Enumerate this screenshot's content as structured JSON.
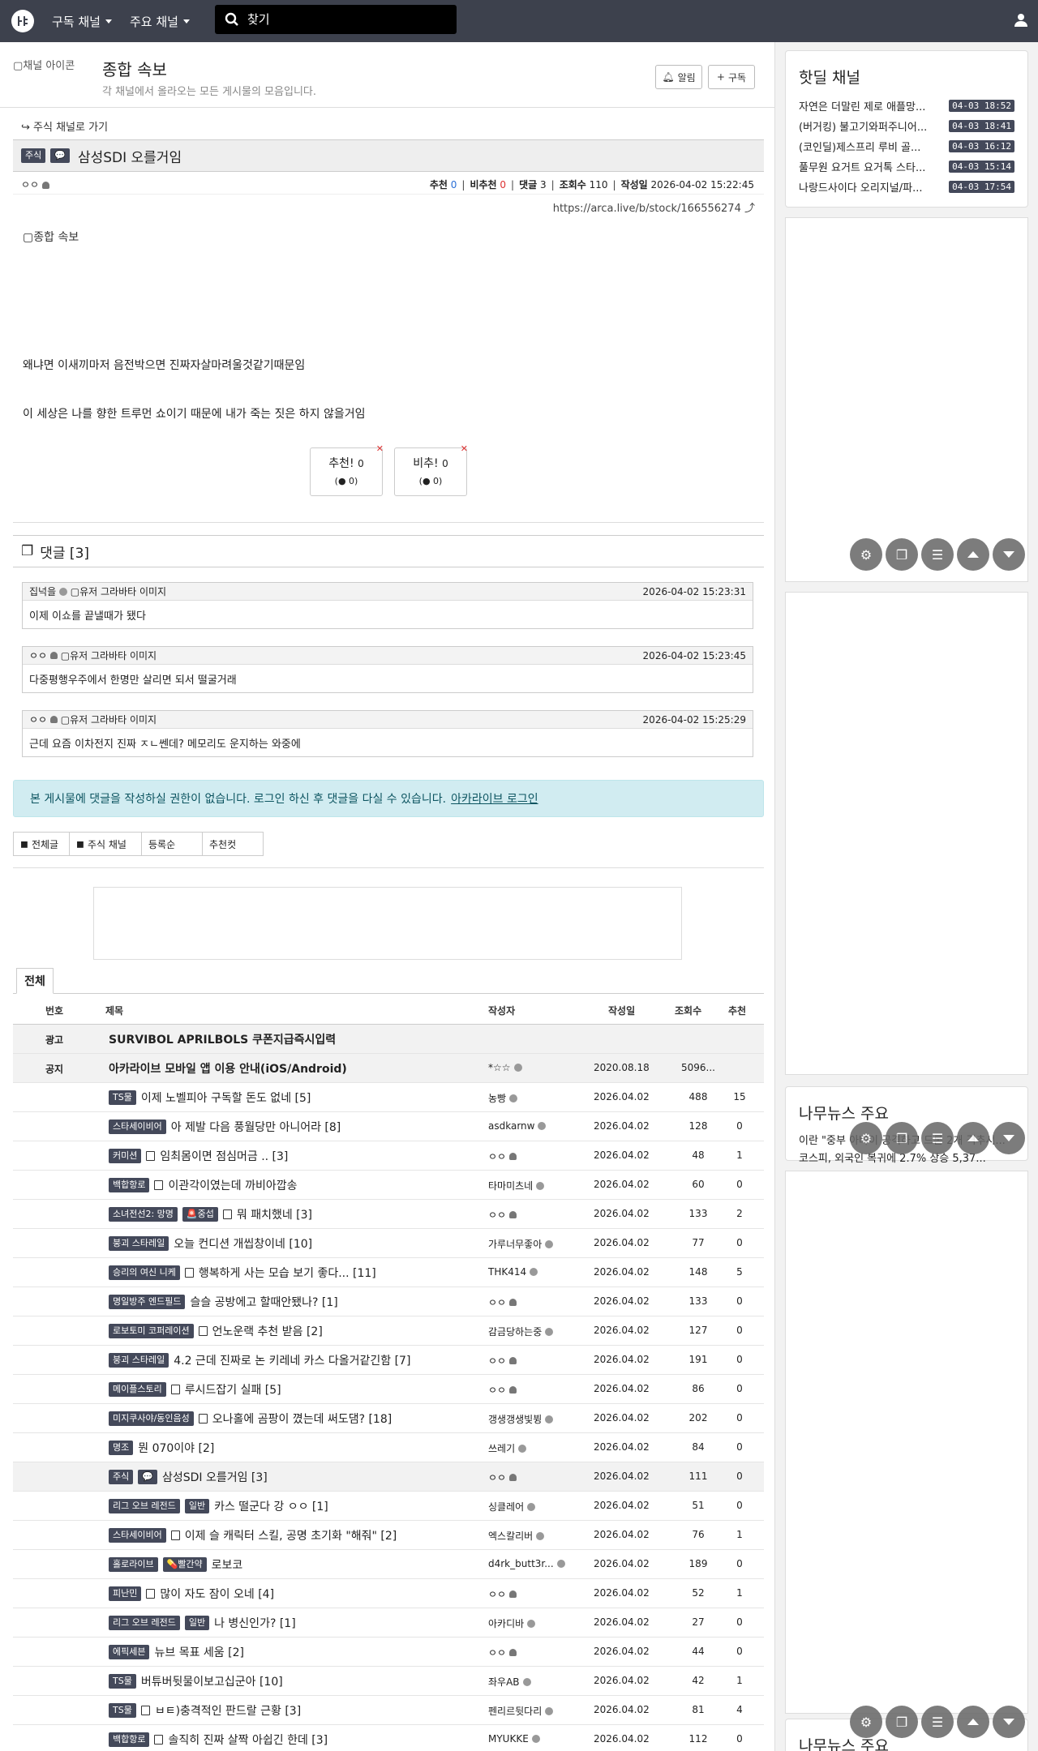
{
  "topbar": {
    "logo": "arca",
    "menu1": "구독 채널",
    "menu2": "주요 채널",
    "search_placeholder": "찾기"
  },
  "channel": {
    "img_alt": "채널 아이콘",
    "title": "종합 속보",
    "desc": "각 채널에서 올라오는 모든 게시물의 모음입니다.",
    "btn_alarm": "알림",
    "btn_sub": "구독"
  },
  "back": "주식 채널로 가기",
  "article": {
    "badge1": "주식",
    "title": "삼성SDI 오를거임",
    "author": "ㅇㅇ",
    "meta": {
      "rec_label": "추천",
      "rec": "0",
      "unrec_label": "비추천",
      "unrec": "0",
      "cmt_label": "댓글",
      "cmt": "3",
      "view_label": "조회수",
      "views": "110",
      "date_label": "작성일",
      "date": "2026-04-02 15:22:45"
    },
    "url": "https://arca.live/b/stock/166556274",
    "img_alt": "종합 속보",
    "p1": "왜냐면 이새끼마저 음전박으면 진짜자살마려울것같기때문임",
    "p2": "이 세상은 나를 향한 트루먼 쇼이기 때문에 내가 죽는 짓은 하지 않을거임",
    "vote_up": "추천!",
    "vote_up_n": "0",
    "vote_up_sub": "0",
    "vote_down": "비추!",
    "vote_down_n": "0",
    "vote_down_sub": "0"
  },
  "comments": {
    "title": "댓글 [3]",
    "items": [
      {
        "author": "집넉을",
        "avatar_alt": "유저 그라바타 이미지",
        "date": "2026-04-02 15:23:31",
        "text": "이제 이쇼를 끝낼때가 됐다"
      },
      {
        "author": "ㅇㅇ",
        "avatar_alt": "유저 그라바타 이미지",
        "date": "2026-04-02 15:23:45",
        "text": "다중평행우주에서 한명만 살리면 되서 떨굴거래"
      },
      {
        "author": "ㅇㅇ",
        "avatar_alt": "유저 그라바타 이미지",
        "date": "2026-04-02 15:25:29",
        "text": "근데 요즘 이차전지 진짜 ㅈㄴ쎈데? 메모리도 운지하는 와중에"
      }
    ]
  },
  "notice": {
    "text": "본 게시물에 댓글을 작성하실 권한이 없습니다. 로그인 하신 후 댓글을 다실 수 있습니다.",
    "link": "아카라이브 로그인"
  },
  "filters": [
    "전체글",
    "주식 채널",
    "등록순",
    "추천컷"
  ],
  "tab": "전체",
  "table": {
    "headers": [
      "번호",
      "제목",
      "작성자",
      "작성일",
      "조회수",
      "추천"
    ],
    "rows": [
      {
        "no": "광고",
        "title": "SURVIBOL APRILBOLS 쿠폰지급즉시입력",
        "bold": true,
        "shaded": true,
        "author": "",
        "date": "",
        "views": "",
        "rec": ""
      },
      {
        "no": "공지",
        "title": "아카라이브 모바일 앱 이용 안내(iOS/Android)",
        "bold": true,
        "shaded": true,
        "author": "*☆☆",
        "date": "2020.08.18",
        "views": "5096...",
        "rec": ""
      },
      {
        "no": "",
        "badges": [
          "TS물"
        ],
        "title": "이제 노벨피아 구독할 돈도 없네 [5]",
        "author": "농빵",
        "date": "2026.04.02",
        "views": "488",
        "rec": "15"
      },
      {
        "no": "",
        "badges": [
          "스타세이비어"
        ],
        "title": "아 제발 다음 풍월당만 아니어라 [8]",
        "author": "asdkarnw",
        "date": "2026.04.02",
        "views": "128",
        "rec": "0"
      },
      {
        "no": "",
        "badges": [
          "커미션"
        ],
        "doc": true,
        "title": "임최몸이면 점심머금 .. [3]",
        "author": "ㅇㅇ",
        "date": "2026.04.02",
        "views": "48",
        "rec": "1"
      },
      {
        "no": "",
        "badges": [
          "백합항로"
        ],
        "doc": true,
        "title": "이관각이였는데 까비아깝송",
        "author": "타마미츠네",
        "date": "2026.04.02",
        "views": "60",
        "rec": "0"
      },
      {
        "no": "",
        "badges": [
          "소녀전선2: 망명",
          "🚨중섭"
        ],
        "doc": true,
        "title": "뭐 패치했네 [3]",
        "author": "ㅇㅇ",
        "date": "2026.04.02",
        "views": "133",
        "rec": "2"
      },
      {
        "no": "",
        "badges": [
          "붕괴 스타레일"
        ],
        "title": "오늘 컨디션 개씹창이네 [10]",
        "author": "가루너무좋아",
        "date": "2026.04.02",
        "views": "77",
        "rec": "0"
      },
      {
        "no": "",
        "badges": [
          "승리의 여신 니케"
        ],
        "doc": true,
        "title": "행복하게 사는 모습 보기 좋다... [11]",
        "author": "THK414",
        "date": "2026.04.02",
        "views": "148",
        "rec": "5"
      },
      {
        "no": "",
        "badges": [
          "명일방주 엔드필드"
        ],
        "title": "슬슬 공방에고 할때안됐나? [1]",
        "author": "ㅇㅇ",
        "date": "2026.04.02",
        "views": "133",
        "rec": "0"
      },
      {
        "no": "",
        "badges": [
          "로보토미 코퍼레이션"
        ],
        "doc": true,
        "title": "언노운랙 추천 받음 [2]",
        "author": "감금당하는중",
        "date": "2026.04.02",
        "views": "127",
        "rec": "0"
      },
      {
        "no": "",
        "badges": [
          "붕괴 스타레일"
        ],
        "title": "4.2 근데 진짜로 논 키레네 카스 다올거같긴함 [7]",
        "author": "ㅇㅇ",
        "date": "2026.04.02",
        "views": "191",
        "rec": "0"
      },
      {
        "no": "",
        "badges": [
          "메이플스토리"
        ],
        "doc": true,
        "title": "루시드잡기 실패 [5]",
        "author": "ㅇㅇ",
        "date": "2026.04.02",
        "views": "86",
        "rec": "0"
      },
      {
        "no": "",
        "badges": [
          "미지쿠사야/동인음성"
        ],
        "doc": true,
        "title": "오나홀에 곰팡이 꼈는데 써도댐? [18]",
        "author": "갱생갱생빛뷩",
        "date": "2026.04.02",
        "views": "202",
        "rec": "0"
      },
      {
        "no": "",
        "badges": [
          "명조"
        ],
        "title": "뭔 070이야 [2]",
        "author": "쓰레기",
        "date": "2026.04.02",
        "views": "84",
        "rec": "0"
      },
      {
        "no": "",
        "badges": [
          "주식",
          "💬"
        ],
        "title": "삼성SDI 오를거임 [3]",
        "shaded": true,
        "author": "ㅇㅇ",
        "date": "2026.04.02",
        "views": "111",
        "rec": "0"
      },
      {
        "no": "",
        "badges": [
          "리그 오브 레전드",
          "일반"
        ],
        "title": "카스 떨군다 강 ㅇㅇ [1]",
        "author": "싱클레어",
        "date": "2026.04.02",
        "views": "51",
        "rec": "0"
      },
      {
        "no": "",
        "badges": [
          "스타세이비어"
        ],
        "doc": true,
        "title": "이제 슬 캐릭터 스킬, 공명 초기화 \"해줘\" [2]",
        "author": "엑스칼리버",
        "date": "2026.04.02",
        "views": "76",
        "rec": "1"
      },
      {
        "no": "",
        "badges": [
          "홀로라이브",
          "💊빨간약"
        ],
        "title": "로보코",
        "author": "d4rk_butt3r...",
        "date": "2026.04.02",
        "views": "189",
        "rec": "0"
      },
      {
        "no": "",
        "badges": [
          "피난민"
        ],
        "doc": true,
        "title": "많이 자도 잠이 오네 [4]",
        "author": "ㅇㅇ",
        "date": "2026.04.02",
        "views": "52",
        "rec": "1"
      },
      {
        "no": "",
        "badges": [
          "리그 오브 레전드",
          "일반"
        ],
        "title": "나 병신인가? [1]",
        "author": "아카디바",
        "date": "2026.04.02",
        "views": "27",
        "rec": "0"
      },
      {
        "no": "",
        "badges": [
          "에픽세븐"
        ],
        "title": "뉴브 목표 세움 [2]",
        "author": "ㅇㅇ",
        "date": "2026.04.02",
        "views": "44",
        "rec": "0"
      },
      {
        "no": "",
        "badges": [
          "TS물"
        ],
        "title": "버튜버뒷물이보고십군아 [10]",
        "author": "좌우AB",
        "date": "2026.04.02",
        "views": "42",
        "rec": "1"
      },
      {
        "no": "",
        "badges": [
          "TS물"
        ],
        "doc": true,
        "title": "ㅂㅌ)충격적인 판드랄 근황 [3]",
        "author": "펜리르뒷다리",
        "date": "2026.04.02",
        "views": "81",
        "rec": "4"
      },
      {
        "no": "",
        "badges": [
          "백합항로"
        ],
        "doc": true,
        "title": "솔직히 진짜 살짝 아쉽긴 한데 [3]",
        "author": "MYUKKE",
        "date": "2026.04.02",
        "views": "112",
        "rec": "0"
      }
    ]
  },
  "side": {
    "hot_title": "핫딜 채널",
    "hot": [
      {
        "t": "자연은 더말린 제로 애플망...",
        "time": "04-03 18:52"
      },
      {
        "t": "(버거킹) 불고기와퍼주니어...",
        "time": "04-03 18:41"
      },
      {
        "t": "(코인딜)제스프리 루비 골...",
        "time": "04-03 16:12"
      },
      {
        "t": "풀무원 요거트 요거톡 스타...",
        "time": "04-03 15:14"
      },
      {
        "t": "나랑드사이다 오리지널/파...",
        "time": "04-03 17:54"
      }
    ],
    "news_title": "나무뉴스 주요",
    "news1": "이란 \"중부 아바이 공격하고 드론 2개 격추시...",
    "news2": "코스피, 외국인 복귀에 2.7% 상승 5,37..."
  },
  "colors": {
    "topbar": "#3d414d",
    "badge": "#44495a",
    "notice_bg": "#d1ecf1",
    "notice_text": "#0c5460"
  }
}
